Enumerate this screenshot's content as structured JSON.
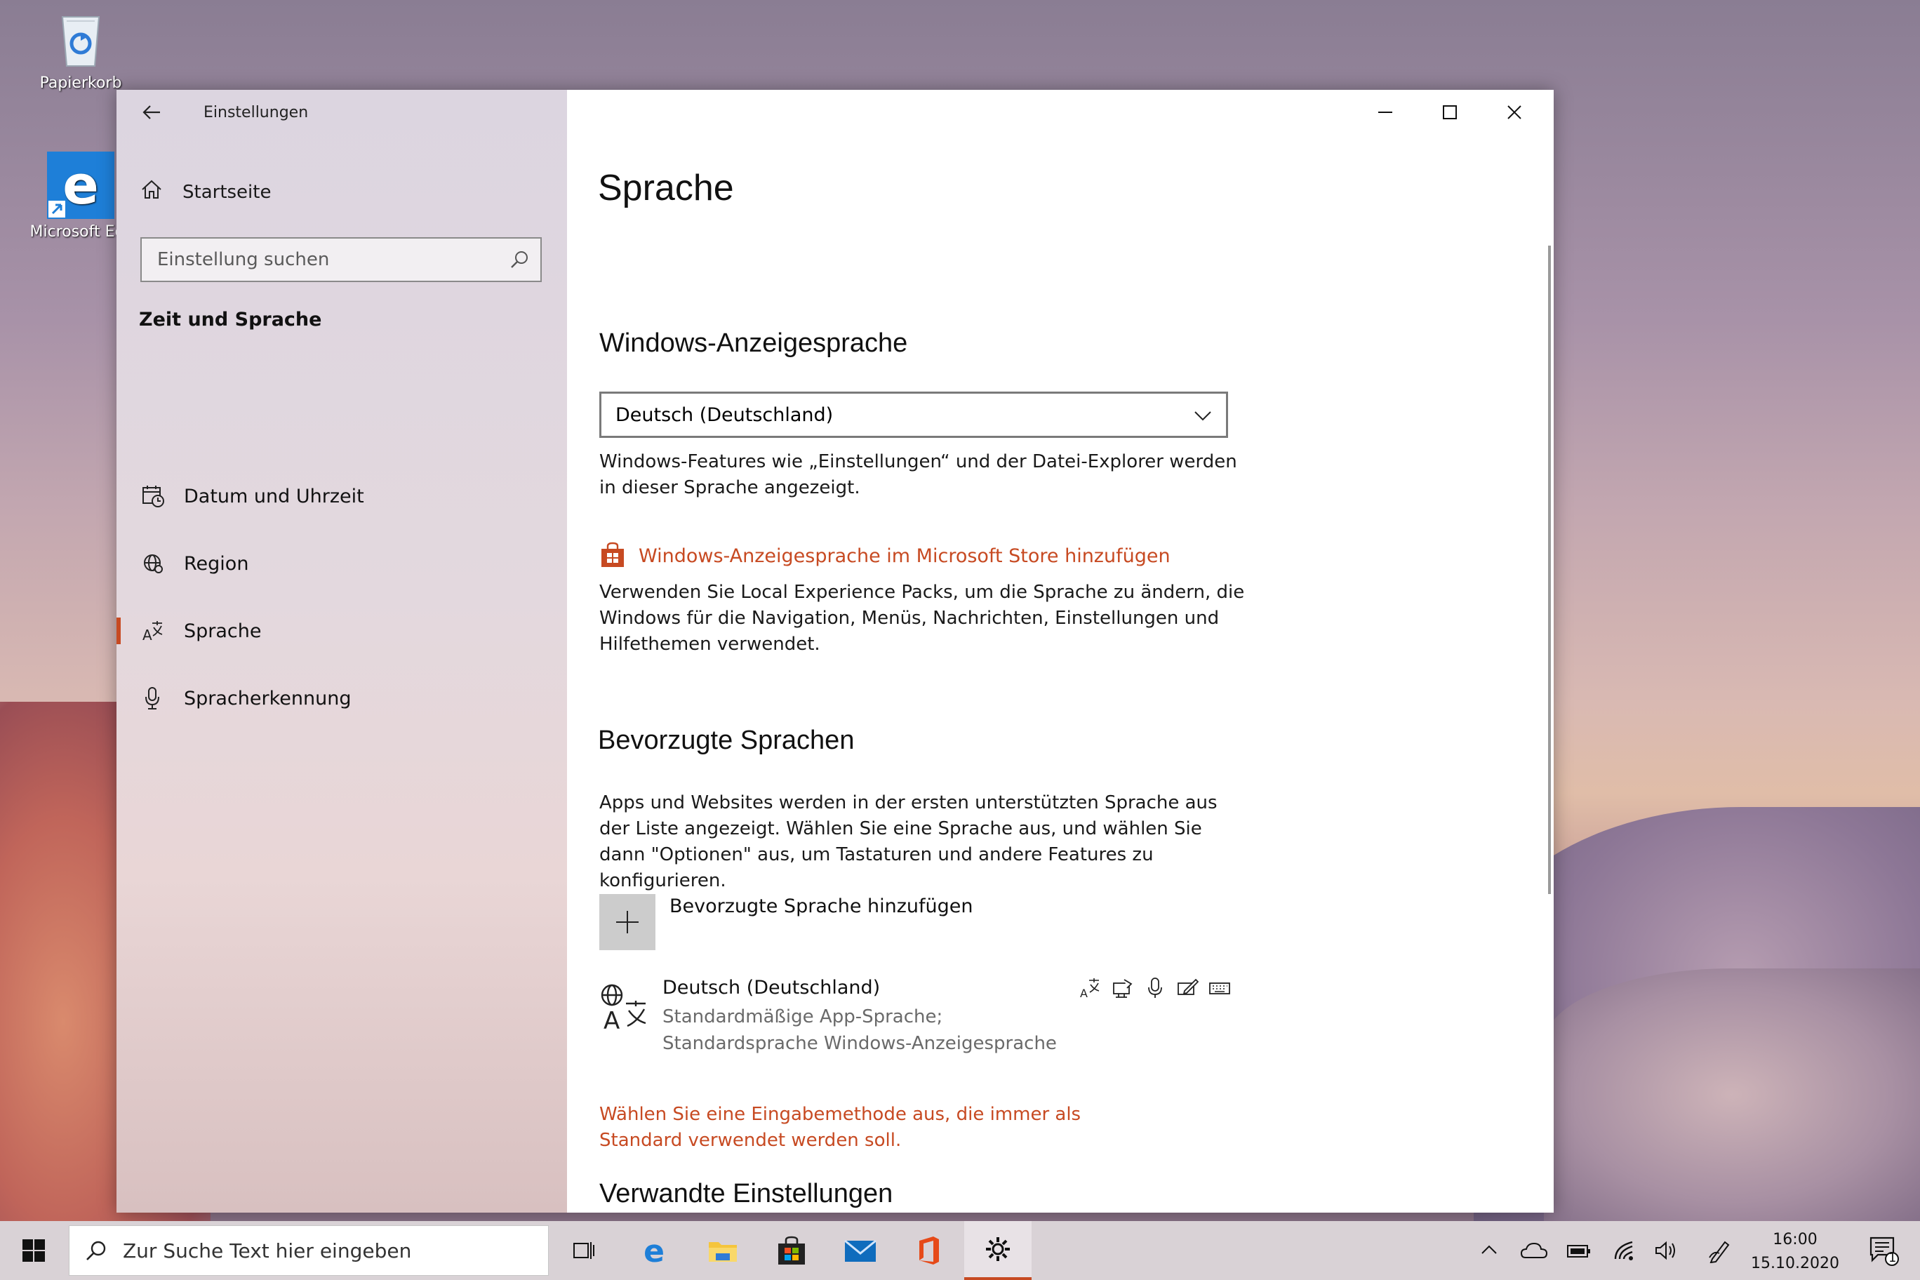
{
  "desktop": {
    "icons": [
      {
        "label": "Papierkorb"
      },
      {
        "label": "Microsoft Ed"
      }
    ]
  },
  "window": {
    "title": "Einstellungen",
    "sidebar": {
      "home_label": "Startseite",
      "search_placeholder": "Einstellung suchen",
      "section_label": "Zeit und Sprache",
      "items": [
        {
          "label": "Datum und Uhrzeit",
          "icon": "calendar-clock-icon"
        },
        {
          "label": "Region",
          "icon": "globe-icon"
        },
        {
          "label": "Sprache",
          "icon": "language-icon",
          "selected": true
        },
        {
          "label": "Spracherkennung",
          "icon": "microphone-icon"
        }
      ]
    },
    "main": {
      "page_title": "Sprache",
      "display_language": {
        "heading": "Windows-Anzeigesprache",
        "selected": "Deutsch (Deutschland)",
        "description": "Windows-Features wie „Einstellungen“ und der Datei-Explorer werden in dieser Sprache angezeigt.",
        "store_link": "Windows-Anzeigesprache im Microsoft Store hinzufügen",
        "store_description": "Verwenden Sie Local Experience Packs, um die Sprache zu ändern, die Windows für die Navigation, Menüs, Nachrichten, Einstellungen und Hilfethemen verwendet."
      },
      "preferred": {
        "heading": "Bevorzugte Sprachen",
        "description": "Apps und Websites werden in der ersten unterstützten Sprache aus der Liste angezeigt. Wählen Sie eine Sprache aus, und wählen Sie dann \"Optionen\" aus, um Tastaturen und andere Features zu konfigurieren.",
        "add_label": "Bevorzugte Sprache hinzufügen",
        "languages": [
          {
            "name": "Deutsch (Deutschland)",
            "description": "Standardmäßige App-Sprache; Standardsprache Windows-Anzeigesprache"
          }
        ],
        "input_method_link": "Wählen Sie eine Eingabemethode aus, die immer als Standard verwendet werden soll."
      },
      "related_heading": "Verwandte Einstellungen"
    },
    "accent_color": "#c74a22"
  },
  "taskbar": {
    "search_placeholder": "Zur Suche Text hier eingeben",
    "time": "16:00",
    "date": "15.10.2020",
    "notification_count": "1"
  }
}
